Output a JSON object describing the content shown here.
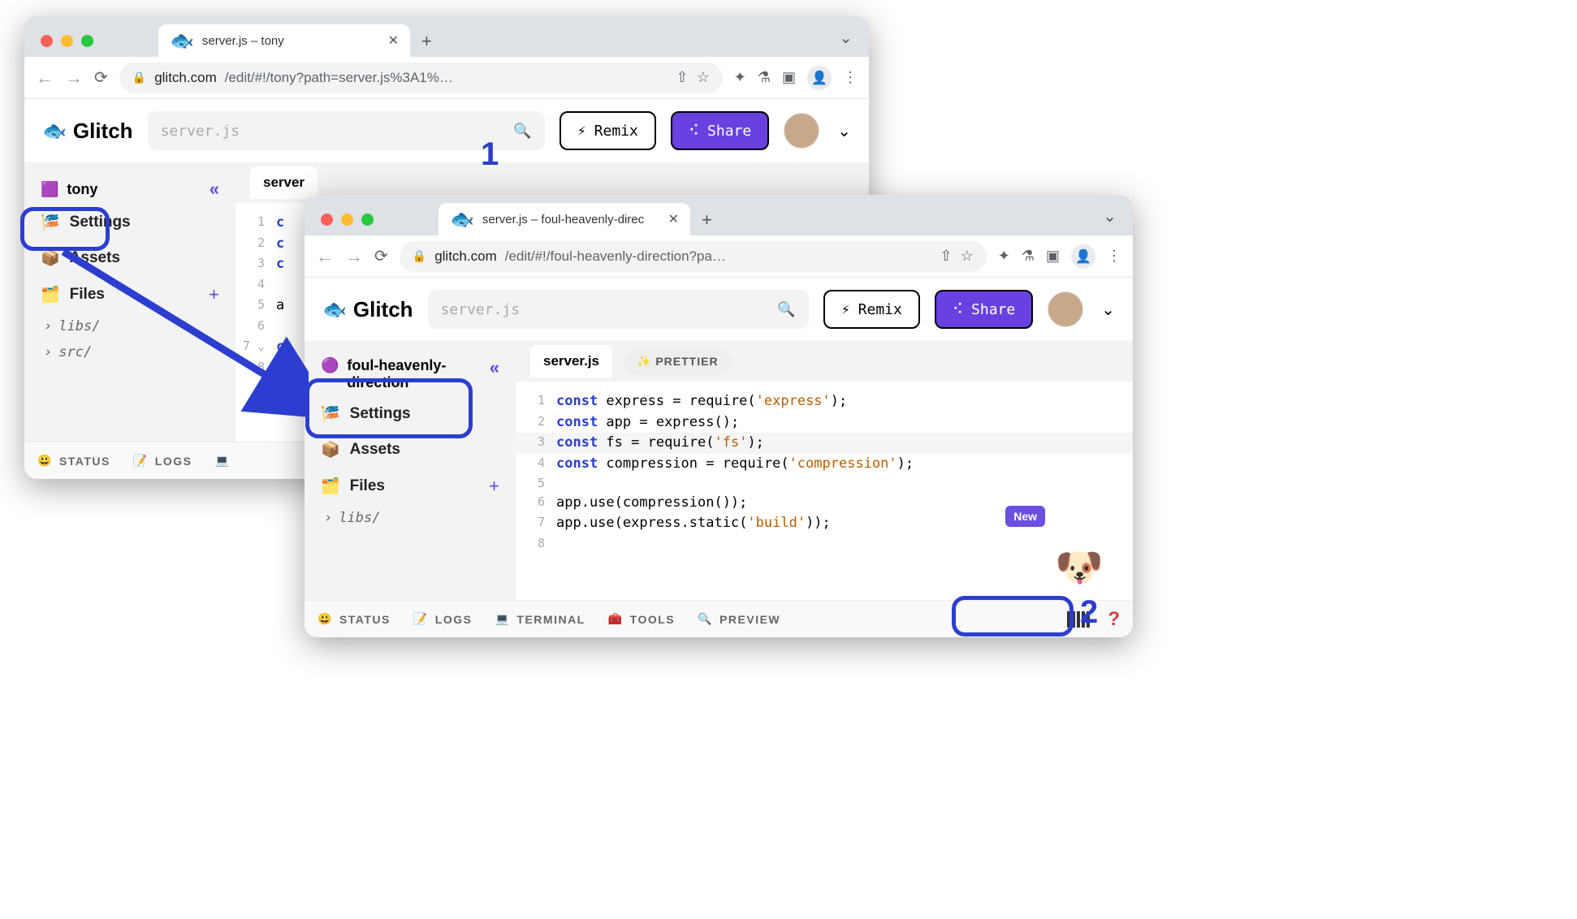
{
  "annotations": {
    "label1": "1",
    "label2": "2"
  },
  "window1": {
    "tab_title": "server.js – tony",
    "url_host": "glitch.com",
    "url_path": "/edit/#!/tony?path=server.js%3A1%…",
    "header": {
      "brand": "Glitch",
      "search_placeholder": "server.js",
      "remix_label": "Remix",
      "share_label": "Share"
    },
    "sidebar": {
      "project_name": "tony",
      "items": [
        {
          "icon": "🎏",
          "label": "Settings"
        },
        {
          "icon": "📦",
          "label": "Assets"
        },
        {
          "icon": "🗂️",
          "label": "Files"
        }
      ],
      "folders": [
        "libs/",
        "src/"
      ]
    },
    "editor": {
      "open_file": "server"
    },
    "footer": {
      "items": [
        {
          "icon": "😃",
          "label": "STATUS"
        },
        {
          "icon": "📝",
          "label": "LOGS"
        }
      ]
    }
  },
  "window2": {
    "tab_title": "server.js – foul-heavenly-direc",
    "url_host": "glitch.com",
    "url_path": "/edit/#!/foul-heavenly-direction?pa…",
    "header": {
      "brand": "Glitch",
      "search_placeholder": "server.js",
      "remix_label": "Remix",
      "share_label": "Share"
    },
    "sidebar": {
      "project_name": "foul-heavenly-direction",
      "items": [
        {
          "icon": "🎏",
          "label": "Settings"
        },
        {
          "icon": "📦",
          "label": "Assets"
        },
        {
          "icon": "🗂️",
          "label": "Files"
        }
      ],
      "folders": [
        "libs/"
      ]
    },
    "editor": {
      "open_file": "server.js",
      "prettier_label": "PRETTIER",
      "code_lines": [
        {
          "n": 1,
          "tokens": [
            [
              "kw",
              "const"
            ],
            [
              "pl",
              " express = require("
            ],
            [
              "str",
              "'express'"
            ],
            [
              "pl",
              ");"
            ]
          ]
        },
        {
          "n": 2,
          "tokens": [
            [
              "kw",
              "const"
            ],
            [
              "pl",
              " app = express();"
            ]
          ]
        },
        {
          "n": 3,
          "hl": true,
          "tokens": [
            [
              "kw",
              "const"
            ],
            [
              "pl",
              " fs = require("
            ],
            [
              "str",
              "'fs'"
            ],
            [
              "pl",
              ");"
            ]
          ]
        },
        {
          "n": 4,
          "tokens": [
            [
              "kw",
              "const"
            ],
            [
              "pl",
              " compression = require("
            ],
            [
              "str",
              "'compression'"
            ],
            [
              "pl",
              ");"
            ]
          ]
        },
        {
          "n": 5,
          "tokens": []
        },
        {
          "n": 6,
          "tokens": [
            [
              "pl",
              "app.use(compression());"
            ]
          ]
        },
        {
          "n": 7,
          "tokens": [
            [
              "pl",
              "app.use(express.static("
            ],
            [
              "str",
              "'build'"
            ],
            [
              "pl",
              "));"
            ]
          ]
        },
        {
          "n": 8,
          "tokens": []
        }
      ]
    },
    "footer": {
      "items": [
        {
          "icon": "😃",
          "label": "STATUS"
        },
        {
          "icon": "📝",
          "label": "LOGS"
        },
        {
          "icon": "💻",
          "label": "TERMINAL"
        },
        {
          "icon": "🧰",
          "label": "TOOLS"
        },
        {
          "icon": "🔍",
          "label": "PREVIEW"
        }
      ],
      "help": "?",
      "badge_new": "New"
    }
  }
}
